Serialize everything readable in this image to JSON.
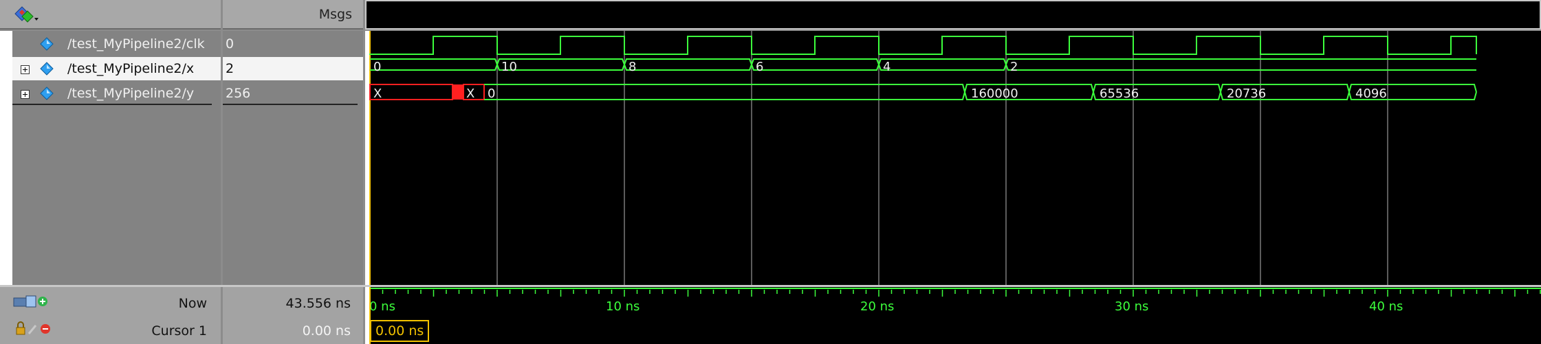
{
  "header": {
    "value_col_label": "Msgs"
  },
  "signals": [
    {
      "path": "/test_MyPipeline2/clk",
      "value": "0",
      "expandable": false
    },
    {
      "path": "/test_MyPipeline2/x",
      "value": "2",
      "expandable": true
    },
    {
      "path": "/test_MyPipeline2/y",
      "value": "256",
      "expandable": true
    }
  ],
  "waveforms": {
    "x_segments": [
      "0",
      "10",
      "8",
      "6",
      "4",
      "2"
    ],
    "y_segments": [
      "X",
      "X",
      "0",
      "160000",
      "65536",
      "20736",
      "4096"
    ]
  },
  "timeline": {
    "unit": "ns",
    "ticks": [
      "0 ns",
      "10 ns",
      "20 ns",
      "30 ns",
      "40 ns"
    ]
  },
  "controls": {
    "now_label": "Now",
    "now_value": "43.556 ns",
    "cursor_label": "Cursor 1",
    "cursor_value": "0.00 ns",
    "cursor_box": "0.00 ns"
  },
  "colors": {
    "wave": "#3cff3c",
    "undefined": "#ff2020",
    "cursor": "#f2c200"
  }
}
